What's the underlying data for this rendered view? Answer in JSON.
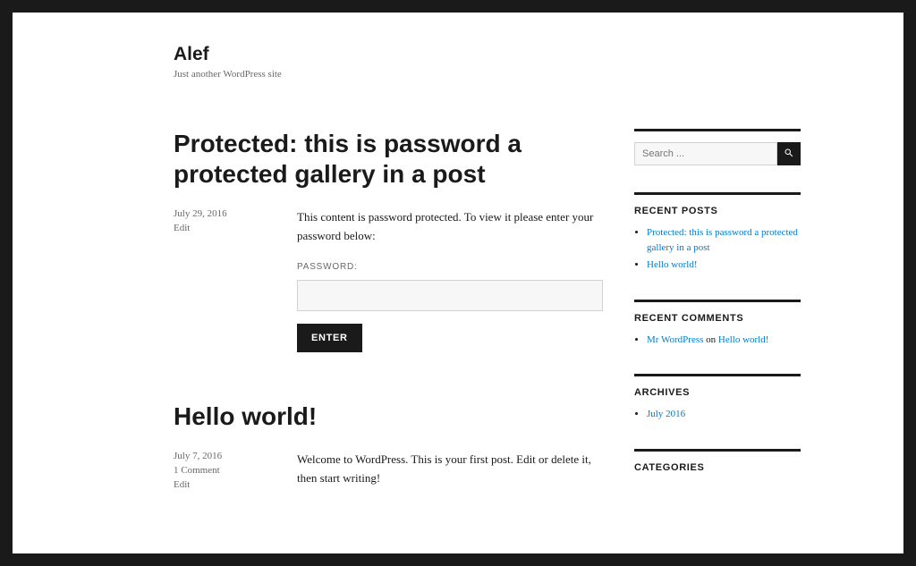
{
  "site": {
    "title": "Alef",
    "tagline": "Just another WordPress site"
  },
  "posts": [
    {
      "title": "Protected: this is password a protected gallery in a post",
      "date": "July 29, 2016",
      "edit_label": "Edit",
      "content": "This content is password protected. To view it please enter your password below:",
      "password_label": "PASSWORD:",
      "submit_label": "ENTER"
    },
    {
      "title": "Hello world!",
      "date": "July 7, 2016",
      "comments": "1 Comment",
      "edit_label": "Edit",
      "content": "Welcome to WordPress. This is your first post. Edit or delete it, then start writing!"
    }
  ],
  "sidebar": {
    "search_placeholder": "Search ...",
    "recent_posts": {
      "title": "RECENT POSTS",
      "items": [
        "Protected: this is password a protected gallery in a post",
        "Hello world!"
      ]
    },
    "recent_comments": {
      "title": "RECENT COMMENTS",
      "author": "Mr WordPress",
      "on": " on ",
      "target": "Hello world!"
    },
    "archives": {
      "title": "ARCHIVES",
      "items": [
        "July 2016"
      ]
    },
    "categories": {
      "title": "CATEGORIES"
    }
  }
}
